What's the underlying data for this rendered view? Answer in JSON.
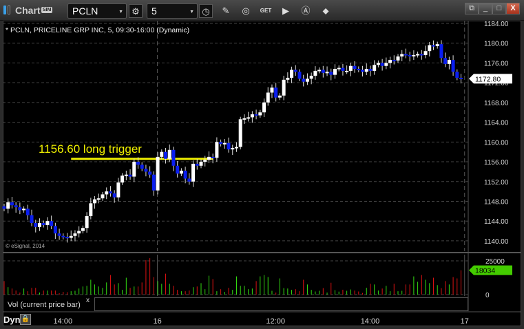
{
  "window": {
    "title": "Chart",
    "sim_badge": "SIM",
    "symbol": "PCLN",
    "interval": "5",
    "controls": [
      "minimize",
      "maximize",
      "close"
    ]
  },
  "toolbar_icons": [
    "gear-icon",
    "clock-icon",
    "pencil-icon",
    "study-icon",
    "get-icon",
    "play-icon",
    "alert-icon",
    "link-icon"
  ],
  "chart": {
    "header": "* PCLN, PRICELINE GRP INC, 5, 09:30-16:00 (Dynamic)",
    "copyright": "© eSignal, 2014",
    "annotation": "1156.60 long trigger",
    "last_price_label": "1172.80",
    "volume_label": "Vol (current price bar)",
    "volume_close": "x",
    "volume_last_label": "18034",
    "dyn_label": "Dyn"
  },
  "colors": {
    "up": "#ffffff",
    "down": "#0a1ef0",
    "vol_up": "#33dd11",
    "vol_down": "#dd1111",
    "trigger": "#f0f000",
    "grid": "#444444"
  },
  "chart_data": {
    "type": "candlestick",
    "title": "PCLN, PRICELINE GRP INC, 5",
    "y_ticks": [
      1184,
      1180,
      1176,
      1172,
      1168,
      1164,
      1160,
      1156,
      1152,
      1148,
      1144,
      1140
    ],
    "ylim": [
      1138.6,
      1185.2
    ],
    "x_ticks": [
      {
        "label": "14:00",
        "bar": 15
      },
      {
        "label": "16",
        "bar": 39
      },
      {
        "label": "12:00",
        "bar": 69
      },
      {
        "label": "14:00",
        "bar": 93
      },
      {
        "label": "17",
        "bar": 117
      }
    ],
    "trigger": {
      "price": 1156.6,
      "from_bar": 17,
      "to_bar": 53
    },
    "volume_ticks": [
      25000,
      0
    ],
    "volume_last": 18034,
    "closes": [
      1146.5,
      1147.8,
      1147.2,
      1146.8,
      1146.2,
      1146.5,
      1145.2,
      1143.6,
      1142.8,
      1143.6,
      1143.2,
      1144.0,
      1143.0,
      1141.5,
      1141.0,
      1140.8,
      1140.6,
      1141.0,
      1141.5,
      1142.0,
      1142.6,
      1145.0,
      1147.6,
      1148.4,
      1148.6,
      1149.4,
      1150.0,
      1149.6,
      1148.8,
      1151.8,
      1153.2,
      1153.4,
      1153.0,
      1156.0,
      1155.4,
      1154.6,
      1154.0,
      1153.4,
      1150.2,
      1157.0,
      1158.0,
      1156.6,
      1158.4,
      1155.2,
      1153.6,
      1154.2,
      1152.6,
      1152.0,
      1155.6,
      1155.2,
      1156.0,
      1156.4,
      1157.0,
      1156.8,
      1160.0,
      1159.6,
      1159.8,
      1158.5,
      1158.8,
      1159.0,
      1164.6,
      1164.8,
      1165.0,
      1165.6,
      1165.4,
      1166.0,
      1168.0,
      1170.0,
      1171.0,
      1169.0,
      1169.4,
      1172.6,
      1173.0,
      1174.6,
      1174.2,
      1172.8,
      1172.2,
      1172.8,
      1173.4,
      1174.4,
      1174.6,
      1174.0,
      1174.2,
      1173.6,
      1174.8,
      1175.0,
      1174.4,
      1174.4,
      1175.4,
      1174.8,
      1174.6,
      1174.2,
      1174.8,
      1174.4,
      1175.6,
      1176.0,
      1175.4,
      1176.0,
      1176.6,
      1176.5,
      1177.3,
      1177.8,
      1177.6,
      1177.4,
      1177.6,
      1177.8,
      1177.6,
      1178.4,
      1179.6,
      1179.4,
      1179.8,
      1177.0,
      1175.8,
      1176.6,
      1174.2,
      1173.0,
      1172.8
    ],
    "volumes": [
      10000,
      5500,
      4500,
      3000,
      1500,
      4500,
      2500,
      5000,
      5000,
      1500,
      3000,
      3000,
      3000,
      3000,
      1000,
      2000,
      1800,
      2500,
      2800,
      4500,
      6000,
      6500,
      11000,
      7500,
      6000,
      5000,
      9000,
      14500,
      7500,
      8500,
      3500,
      12500,
      5000,
      6000,
      6000,
      9000,
      25500,
      27000,
      13000,
      10000,
      8000,
      15500,
      8000,
      6500,
      3500,
      2500,
      2500,
      3000,
      5500,
      6000,
      8500,
      4000,
      14000,
      11500,
      2500,
      4000,
      2000,
      5000,
      3500,
      13500,
      6500,
      6500,
      4000,
      4500,
      10000,
      13500,
      14500,
      13000,
      2800,
      1500,
      12000,
      4800,
      4500,
      3500,
      4000,
      2500,
      11000,
      7500,
      3500,
      2300,
      2800,
      4800,
      1500,
      8800,
      3300,
      2200,
      3600,
      2800,
      3800,
      3000,
      2300,
      1200,
      5000,
      8000,
      7500,
      3000,
      4500,
      6500,
      2500,
      8000,
      2500,
      2800,
      7500,
      7500,
      13500,
      9500,
      14500,
      11000,
      8500,
      12500,
      7000,
      4800,
      10000,
      7500,
      13000,
      12000,
      18034
    ]
  }
}
